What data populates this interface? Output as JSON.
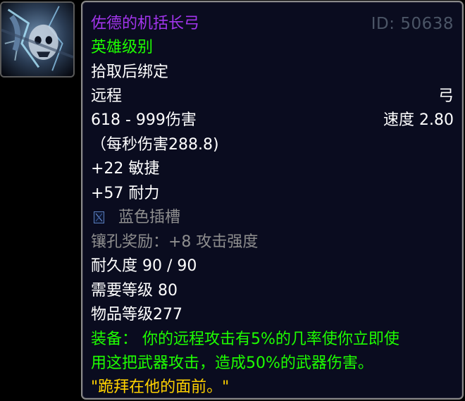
{
  "icon": {
    "name": "crossbow-ice-skull-icon"
  },
  "item": {
    "name": "佐德的机括长弓",
    "id": "ID: 50638",
    "quality": "英雄级别",
    "binding": "拾取后绑定",
    "slot": "远程",
    "type": "弓",
    "damage": "618 - 999伤害",
    "speed": "速度 2.80",
    "dps": "（每秒伤害288.8)",
    "stats": [
      "+22 敏捷",
      "+57 耐力"
    ],
    "socket": "蓝色插槽",
    "socket_bonus": "镶孔奖励：+8 攻击强度",
    "durability": "耐久度 90 / 90",
    "required_level": "需要等级 80",
    "item_level": "物品等级277",
    "equip_line1": "装备： 你的远程攻击有5%的几率使你立即使",
    "equip_line2": "用这把武器攻击，造成50%的武器伤害。",
    "flavor": "\"跪拜在他的面前。\""
  },
  "colors": {
    "epic": "#a335ee",
    "green": "#1eff00",
    "grey": "#8e8e8e",
    "flavor": "#ffd100",
    "id": "#4b5566"
  }
}
